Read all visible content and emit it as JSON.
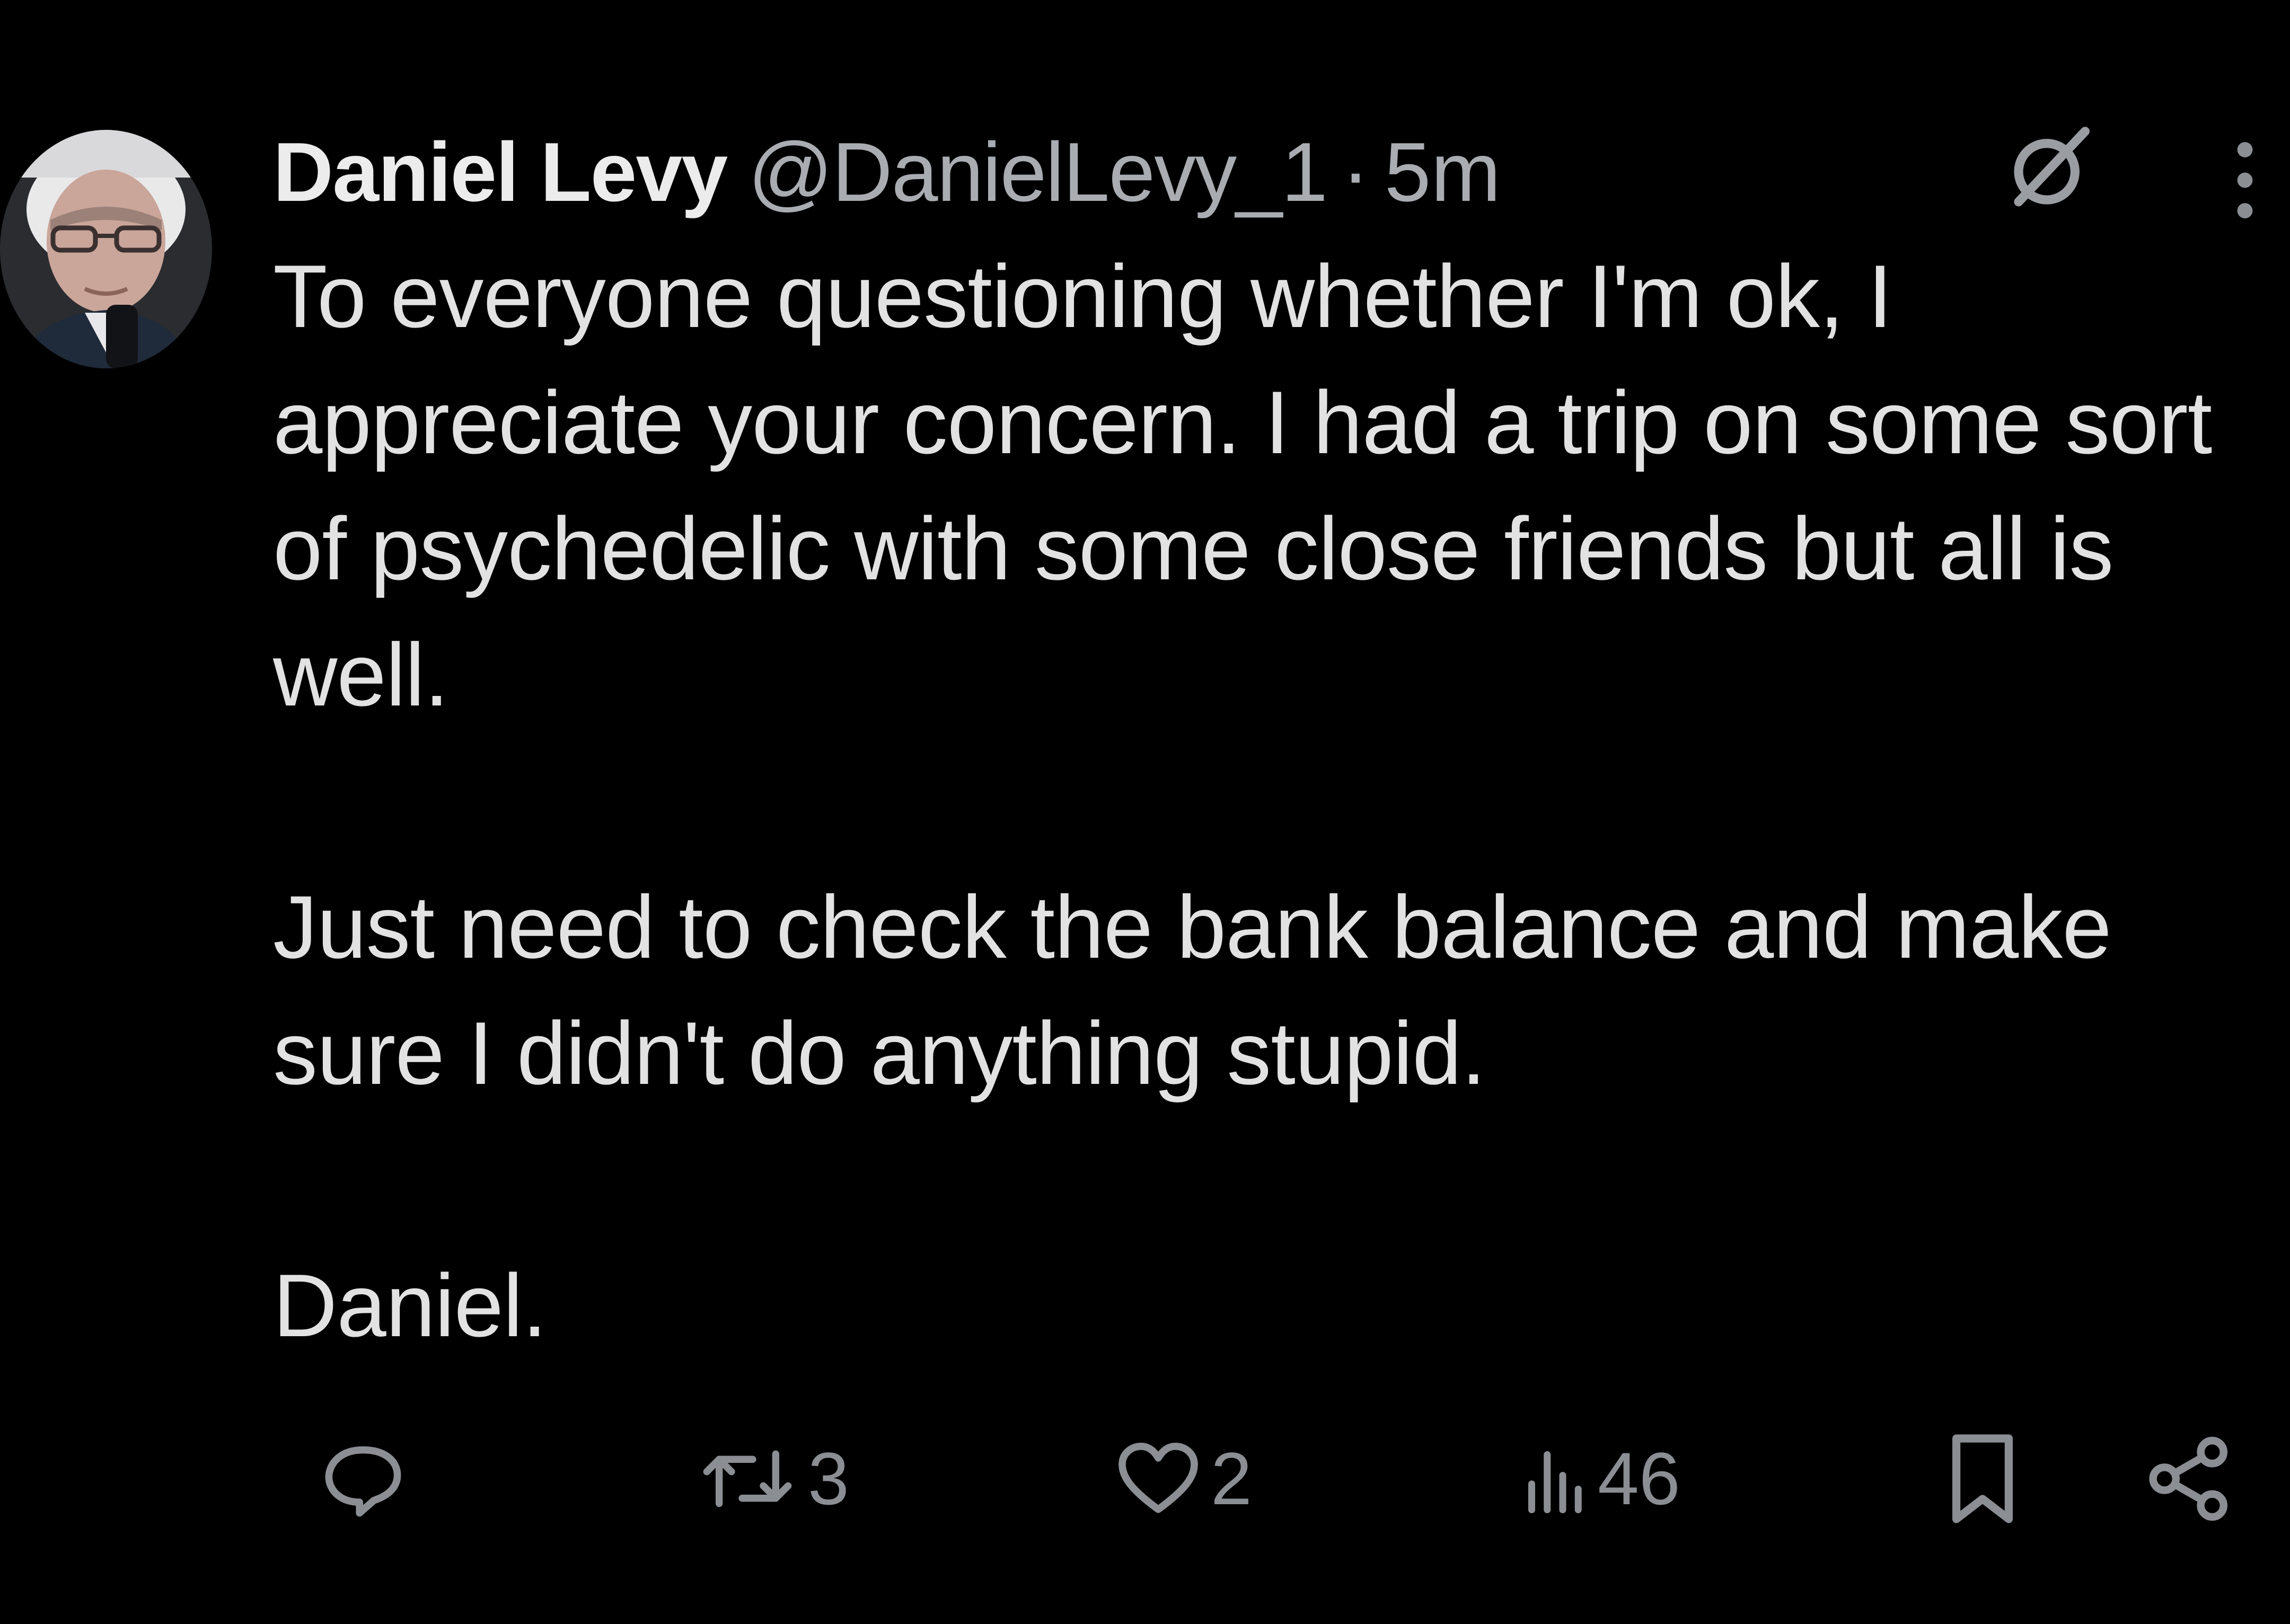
{
  "tweet": {
    "author": {
      "display_name": "Daniel Levy",
      "handle": "@DanielLevy_1",
      "avatar_icon": "profile-photo"
    },
    "separator": "·",
    "timestamp": "5m",
    "paragraphs": [
      "To everyone questioning whether I'm ok, I appreciate your concern. I had a trip on some sort of psychedelic with some close friends but all is well.",
      "Just need to check the bank balance and make sure I didn't do anything stupid.",
      "Daniel."
    ],
    "header_icons": [
      "grok-icon",
      "more-icon"
    ],
    "actions": {
      "reply": {
        "icon": "reply-icon",
        "count": ""
      },
      "retweet": {
        "icon": "retweet-icon",
        "count": "3"
      },
      "like": {
        "icon": "heart-icon",
        "count": "2"
      },
      "views": {
        "icon": "views-icon",
        "count": "46"
      },
      "bookmark": {
        "icon": "bookmark-icon"
      },
      "share": {
        "icon": "share-icon"
      }
    }
  },
  "colors": {
    "background": "#000000",
    "text": "#e7e9ea",
    "muted": "#8b8f94"
  }
}
